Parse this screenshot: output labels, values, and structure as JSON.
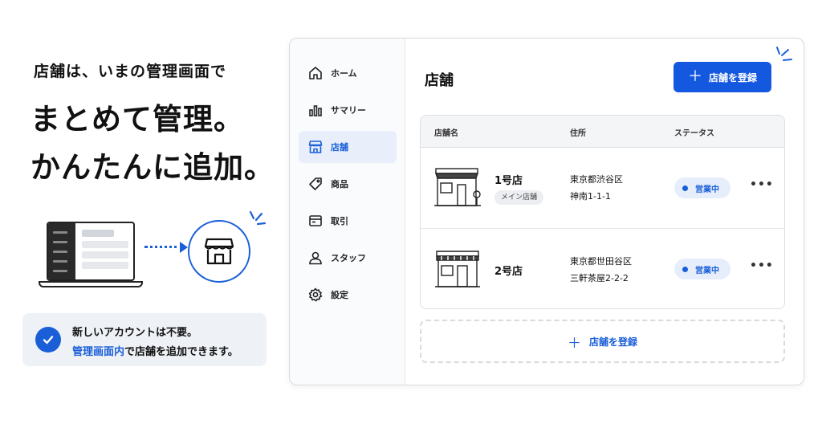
{
  "promo": {
    "headline_small": "店舗は、いまの管理画面で",
    "headline_line1": "まとめて管理。",
    "headline_line2": "かんたんに追加。",
    "notice_line1": "新しいアカウントは不要。",
    "notice_link": "管理画面内",
    "notice_rest": "で店舗を追加できます。",
    "accent_color": "#1a5fd8"
  },
  "sidebar": {
    "items": [
      {
        "label": "ホーム",
        "icon": "home-icon",
        "active": false
      },
      {
        "label": "サマリー",
        "icon": "bar-chart-icon",
        "active": false
      },
      {
        "label": "店舗",
        "icon": "store-icon",
        "active": true
      },
      {
        "label": "商品",
        "icon": "tag-icon",
        "active": false
      },
      {
        "label": "取引",
        "icon": "receipt-icon",
        "active": false
      },
      {
        "label": "スタッフ",
        "icon": "person-icon",
        "active": false
      },
      {
        "label": "設定",
        "icon": "gear-icon",
        "active": false
      }
    ]
  },
  "main": {
    "title": "店舗",
    "register_button": "店舗を登録",
    "add_store_label": "店舗を登録",
    "table": {
      "headers": {
        "name": "店舗名",
        "address": "住所",
        "status": "ステータス"
      },
      "rows": [
        {
          "name": "1号店",
          "badge": "メイン店舗",
          "address_line1": "東京都渋谷区",
          "address_line2": "神南1-1-1",
          "status": "営業中",
          "more": "•••"
        },
        {
          "name": "2号店",
          "badge": "",
          "address_line1": "東京都世田谷区",
          "address_line2": "三軒茶屋2-2-2",
          "status": "営業中",
          "more": "•••"
        }
      ]
    }
  }
}
